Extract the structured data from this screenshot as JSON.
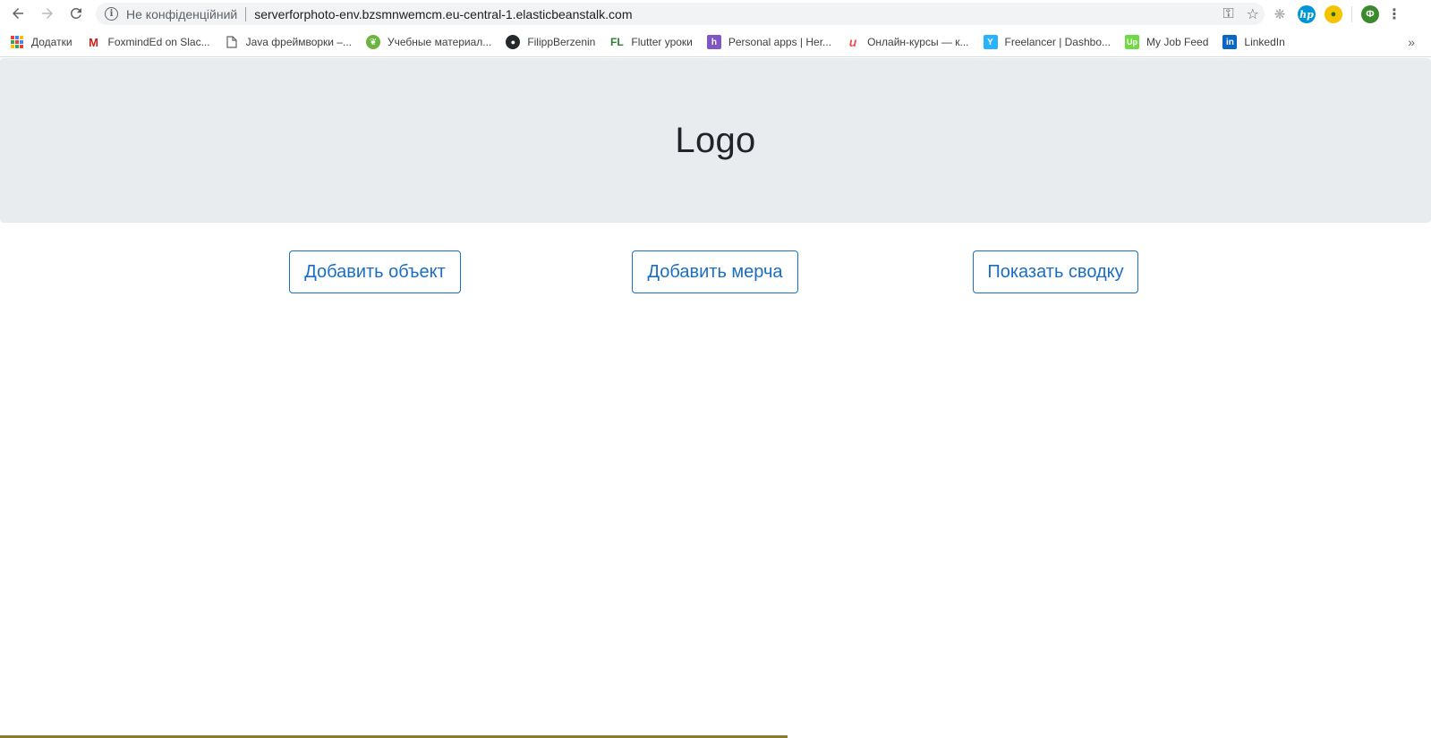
{
  "browser": {
    "not_secure_label": "Не конфіденційний",
    "url": "serverforphoto-env.bzsmnwemcm.eu-central-1.elasticbeanstalk.com",
    "avatar_letter": "Ф",
    "hp_label": "hp",
    "bookmarks": [
      {
        "label": "Додатки",
        "icon": "apps-icon"
      },
      {
        "label": "FoxmindEd on Slac...",
        "icon": "gmail-icon",
        "color": "#c5221f"
      },
      {
        "label": "Java фреймворки –...",
        "icon": "page-icon"
      },
      {
        "label": "Учебные материал...",
        "icon": "spring-icon",
        "color": "#6db33f"
      },
      {
        "label": "FilippBerzenin",
        "icon": "github-icon"
      },
      {
        "label": "Flutter уроки",
        "icon": "fl-icon",
        "icon_text": "FL",
        "color": "#2e7d32"
      },
      {
        "label": "Personal apps | Her...",
        "icon": "heroku-icon",
        "icon_text": "h",
        "color": "#7e57c2"
      },
      {
        "label": "Онлайн-курсы — к...",
        "icon": "udemy-icon",
        "icon_text": "u",
        "color": "#ec5252"
      },
      {
        "label": "Freelancer | Dashbo...",
        "icon": "freelancer-icon",
        "icon_text": "Y",
        "color": "#29b2fe"
      },
      {
        "label": "My Job Feed",
        "icon": "upwork-icon",
        "icon_text": "Up",
        "color": "#6fda44"
      },
      {
        "label": "LinkedIn",
        "icon": "linkedin-icon",
        "icon_text": "in",
        "color": "#0a66c2"
      }
    ]
  },
  "page": {
    "logo": "Logo",
    "buttons": {
      "add_object": "Добавить объект",
      "add_merch": "Добавить мерча",
      "show_summary": "Показать сводку"
    }
  }
}
